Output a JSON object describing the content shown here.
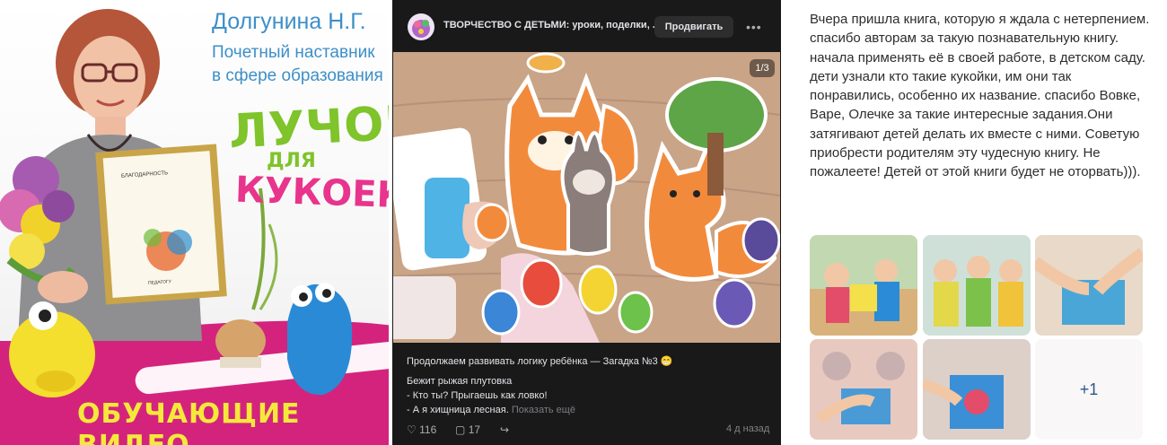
{
  "promo": {
    "name": "Долгунина Н.Г.",
    "subtitle_line1": "Почетный наставник",
    "subtitle_line2": "в сфере образования",
    "title_line1": "ЛУЧОК",
    "title_line2": "ДЛЯ",
    "title_line3": "КУКОЕК",
    "cta": "ОБУЧАЮЩИЕ ВИДЕО",
    "certificate_heading": "БЛАГОДАРНОСТЬ",
    "certificate_footer": "ПЕДАГОГУ",
    "colors": {
      "name": "#3d8fc8",
      "green": "#7ec42a",
      "pink": "#e8348c",
      "band": "#d4237d",
      "cta": "#f4e93a"
    }
  },
  "post": {
    "group_name": "ТВОРЧЕСТВО С ДЕТЬМИ: уроки, поделки, ...",
    "promote_label": "Продвигать",
    "more_icon": "more-horizontal-icon",
    "photo_counter": "1/3",
    "line1": "Продолжаем развивать логику ребёнка — Загадка №3 😁",
    "line2": "Бежит рыжая плутовка",
    "line3": "- Кто ты? Прыгаешь как ловко!",
    "line4": "- А я хищница лесная.",
    "show_more": "Показать ещё",
    "likes": "116",
    "comments": "17",
    "time": "4 д назад",
    "icons": {
      "like": "heart-icon",
      "comment": "comment-icon",
      "share": "share-icon"
    },
    "colors": {
      "bg": "#19191a",
      "link": "#71aaeb"
    }
  },
  "review": {
    "text": "Вчера пришла книга, которую я ждала с нетерпением. спасибо авторам за такую познавательную книгу. начала применять её в своей работе, в детском саду. дети узнали кто такие кукойки, им они так понравились, особенно их название. спасибо Вовке, Варе, Олечке за такие интересные задания.Они затягивают детей делать их вместе с ними. Советую приобрести родителям эту чудесную книгу. Не пожалеете! Детей от этой книги будет не оторвать))).",
    "more_photos": "+1"
  }
}
